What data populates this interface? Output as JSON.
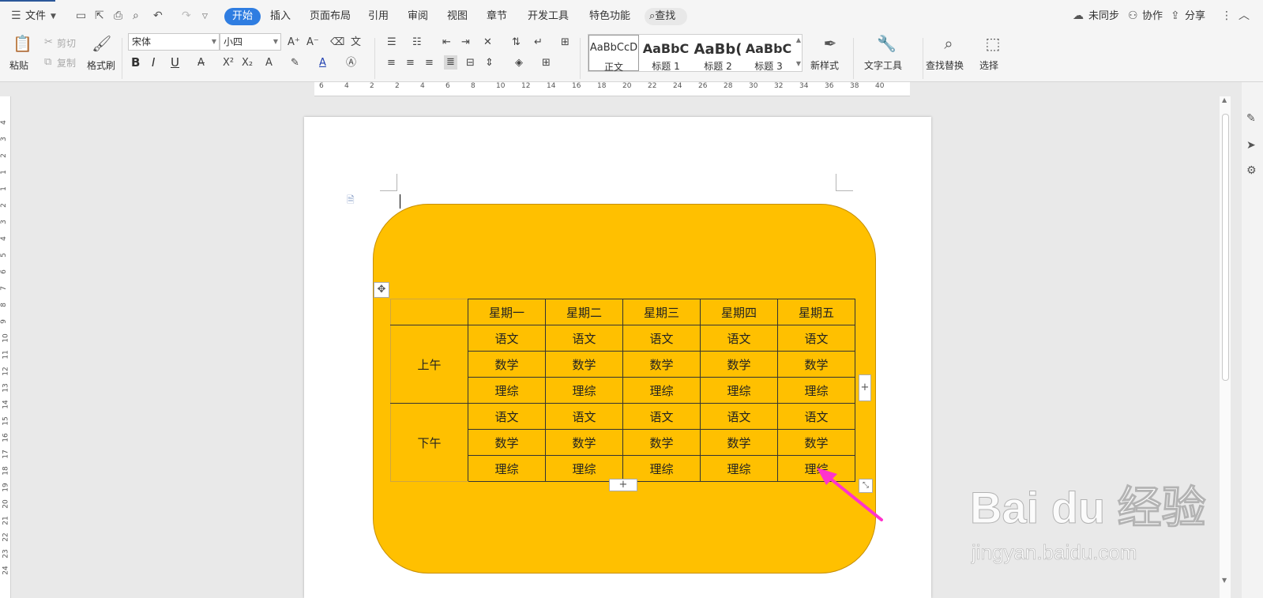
{
  "menubar": {
    "file_label": "文件",
    "tabs": [
      {
        "label": "开始",
        "active": true
      },
      {
        "label": "插入"
      },
      {
        "label": "页面布局"
      },
      {
        "label": "引用"
      },
      {
        "label": "审阅"
      },
      {
        "label": "视图"
      },
      {
        "label": "章节"
      },
      {
        "label": "开发工具"
      },
      {
        "label": "特色功能"
      }
    ],
    "search_label": "查找",
    "sync_label": "未同步",
    "collab_label": "协作",
    "share_label": "分享",
    "accent": "#2f7de1"
  },
  "ribbon": {
    "paste": "粘贴",
    "cut": "剪切",
    "copy": "复制",
    "format_painter": "格式刷",
    "font_name": "宋体",
    "font_size": "小四",
    "bold": "B",
    "italic": "I",
    "underline": "U",
    "styles": [
      {
        "sample": "AaBbCcD",
        "name": "正文",
        "selected": true
      },
      {
        "sample": "AaBbC",
        "name": "标题 1"
      },
      {
        "sample": "AaBb(",
        "name": "标题 2"
      },
      {
        "sample": "AaBbC",
        "name": "标题 3"
      }
    ],
    "new_style": "新样式",
    "text_tools": "文字工具",
    "find_replace": "查找替换",
    "select": "选择"
  },
  "ruler": {
    "h_ticks": [
      "6",
      "4",
      "2",
      "2",
      "4",
      "6",
      "8",
      "10",
      "12",
      "14",
      "16",
      "18",
      "20",
      "22",
      "24",
      "26",
      "28",
      "30",
      "32",
      "34",
      "36",
      "38",
      "40"
    ],
    "v_ticks": [
      "4",
      "3",
      "2",
      "1",
      "1",
      "2",
      "3",
      "4",
      "5",
      "6",
      "7",
      "8",
      "9",
      "10",
      "11",
      "12",
      "13",
      "14",
      "15",
      "16",
      "17",
      "18",
      "19",
      "20",
      "21",
      "22",
      "23",
      "24"
    ]
  },
  "document": {
    "shape_color": "#ffc000",
    "table": {
      "header": [
        "",
        "星期一",
        "星期二",
        "星期三",
        "星期四",
        "星期五"
      ],
      "morning_label": "上午",
      "afternoon_label": "下午",
      "morning_rows": [
        [
          "语文",
          "语文",
          "语文",
          "语文",
          "语文"
        ],
        [
          "数学",
          "数学",
          "数学",
          "数学",
          "数学"
        ],
        [
          "理综",
          "理综",
          "理综",
          "理综",
          "理综"
        ]
      ],
      "afternoon_rows": [
        [
          "语文",
          "语文",
          "语文",
          "语文",
          "语文"
        ],
        [
          "数学",
          "数学",
          "数学",
          "数学",
          "数学"
        ],
        [
          "理综",
          "理综",
          "理综",
          "理综",
          "理综"
        ]
      ]
    },
    "add_row_symbol": "+",
    "add_col_symbol": "+"
  },
  "watermark": {
    "logo_text": "Bai du 经验",
    "url_text": "jingyan.baidu.com"
  }
}
